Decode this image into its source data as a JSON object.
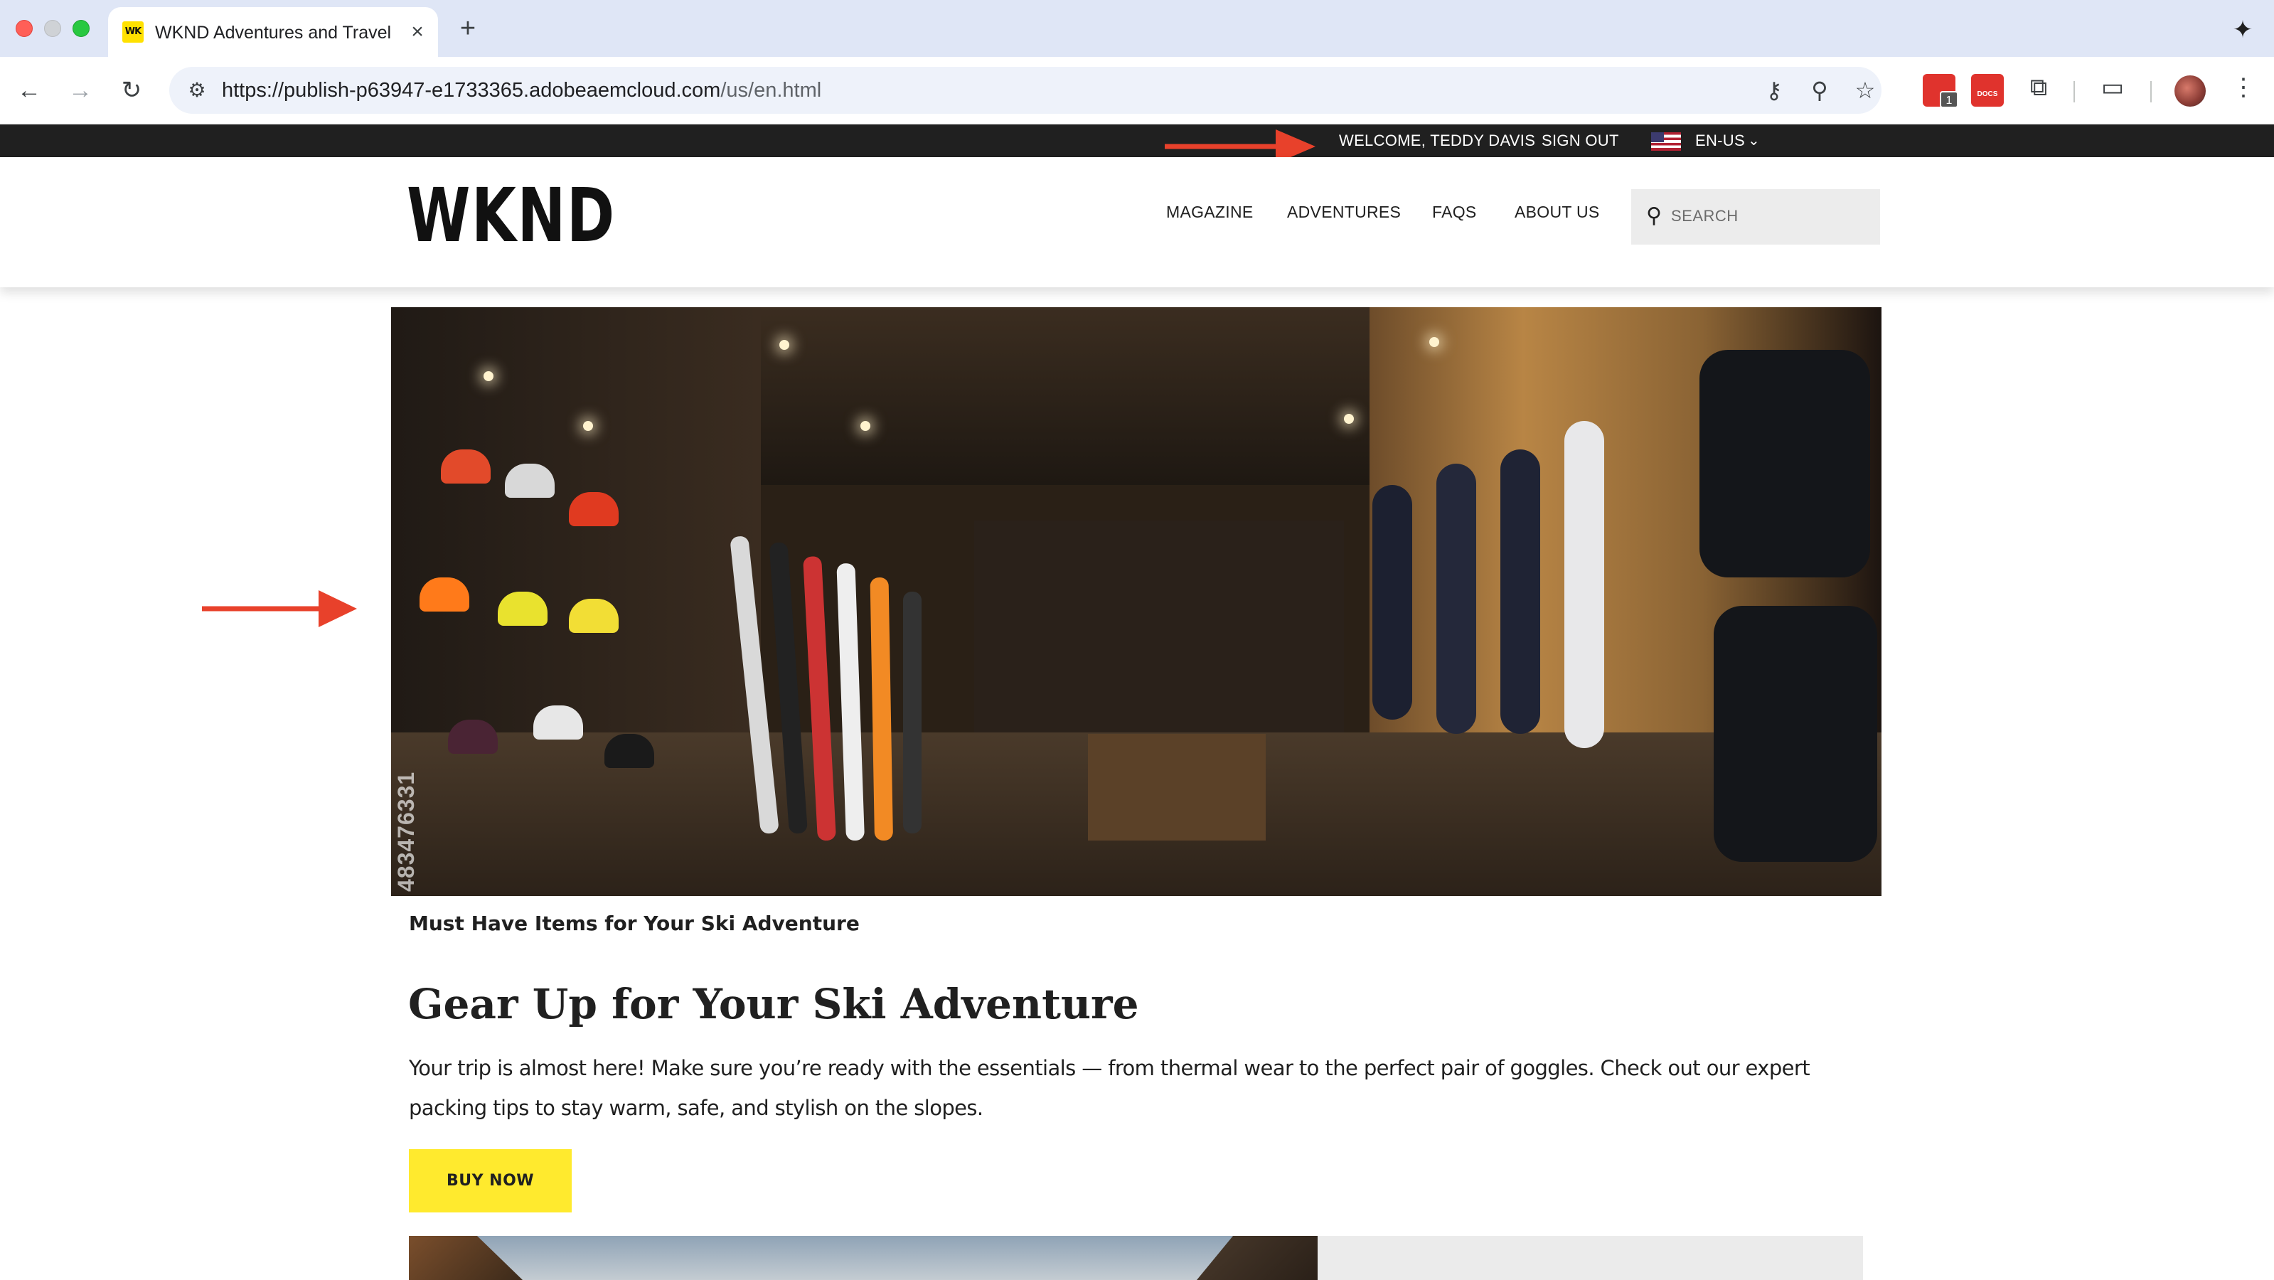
{
  "browser": {
    "tab_title": "WKND Adventures and Travel",
    "favicon_text": "WK",
    "url_host": "https://publish-p63947-e1733365.adobeaemcloud.com",
    "url_path": "/us/en.html",
    "extension_badge": "1",
    "extension_docs_label": "DOCS"
  },
  "utility": {
    "welcome": "WELCOME, TEDDY DAVIS",
    "sign_out": "SIGN OUT",
    "language": "EN-US"
  },
  "header": {
    "logo": "WKND",
    "nav": [
      "MAGAZINE",
      "ADVENTURES",
      "FAQS",
      "ABOUT US"
    ],
    "search_placeholder": "SEARCH"
  },
  "hero": {
    "stock_id": "483476331",
    "caption": "Must Have Items for Your Ski Adventure"
  },
  "article": {
    "title": "Gear Up for Your Ski Adventure",
    "description": "Your trip is almost here! Make sure you’re ready with the essentials — from thermal wear to the perfect pair of goggles. Check out our expert packing tips to stay warm, safe, and stylish on the slopes.",
    "cta": "BUY NOW"
  },
  "colors": {
    "utility_bar": "#202020",
    "cta": "#ffea2e",
    "annotation_arrow": "#e8412b"
  }
}
